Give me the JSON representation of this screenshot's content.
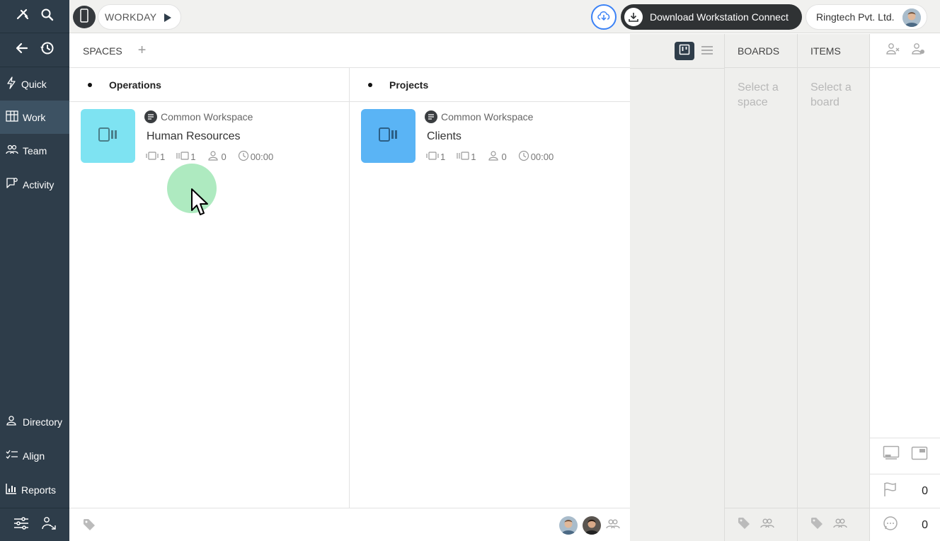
{
  "topbar": {
    "workday_label": "WORKDAY",
    "download_label": "Download Workstation Connect",
    "org_name": "Ringtech Pvt. Ltd."
  },
  "sidebar": {
    "items": [
      {
        "label": "Quick",
        "icon": "lightning-icon"
      },
      {
        "label": "Work",
        "icon": "board-icon",
        "active": true
      },
      {
        "label": "Team",
        "icon": "team-icon"
      },
      {
        "label": "Activity",
        "icon": "activity-icon"
      }
    ],
    "bottom_items": [
      {
        "label": "Directory",
        "icon": "directory-icon"
      },
      {
        "label": "Align",
        "icon": "align-icon"
      },
      {
        "label": "Reports",
        "icon": "reports-icon"
      }
    ]
  },
  "spaces": {
    "header": "SPACES",
    "columns": [
      {
        "title": "Operations",
        "card": {
          "workspace": "Common Workspace",
          "name": "Human Resources",
          "thumb_color": "#7ee3f2",
          "stats": {
            "boards": "1",
            "items": "1",
            "members": "0",
            "time": "00:00"
          }
        }
      },
      {
        "title": "Projects",
        "card": {
          "workspace": "Common Workspace",
          "name": "Clients",
          "thumb_color": "#5ab4f5",
          "stats": {
            "boards": "1",
            "items": "1",
            "members": "0",
            "time": "00:00"
          }
        }
      }
    ]
  },
  "boards": {
    "header": "BOARDS",
    "hint": "Select a space"
  },
  "items": {
    "header": "ITEMS",
    "hint": "Select a board"
  },
  "right_panel": {
    "flag_count": "0",
    "comment_count": "0"
  },
  "colors": {
    "sidebar_bg": "#2e3d4a",
    "accent_blue": "#3b82f6",
    "dark_pill": "#2f3234"
  }
}
